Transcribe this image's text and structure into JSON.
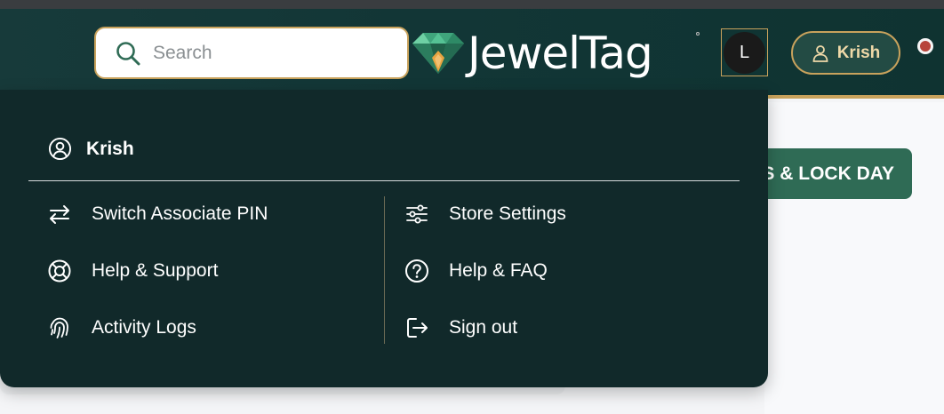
{
  "header": {
    "search": {
      "placeholder": "Search",
      "icon": "search-icon"
    },
    "logo": {
      "text": "JewelTag",
      "icon": "diamond-logo-icon"
    },
    "avatar_initial": "L",
    "user_pill": {
      "label": "Krish",
      "icon": "user-icon"
    },
    "status_dot_color": "#b7443a"
  },
  "page": {
    "action_button_label": "S & LOCK DAY"
  },
  "dropdown": {
    "user_name": "Krish",
    "left_items": [
      {
        "label": "Switch Associate PIN",
        "icon": "swap-arrows-icon"
      },
      {
        "label": "Help & Support",
        "icon": "lifebuoy-icon"
      },
      {
        "label": "Activity Logs",
        "icon": "fingerprint-icon"
      }
    ],
    "right_items": [
      {
        "label": "Store Settings",
        "icon": "sliders-icon"
      },
      {
        "label": "Help & FAQ",
        "icon": "question-circle-icon"
      },
      {
        "label": "Sign out",
        "icon": "sign-out-icon"
      }
    ]
  },
  "colors": {
    "header_bg": "#173a3a",
    "accent_gold": "#c8a25c",
    "dropdown_bg": "#11292a",
    "action_green": "#2f6b55"
  }
}
